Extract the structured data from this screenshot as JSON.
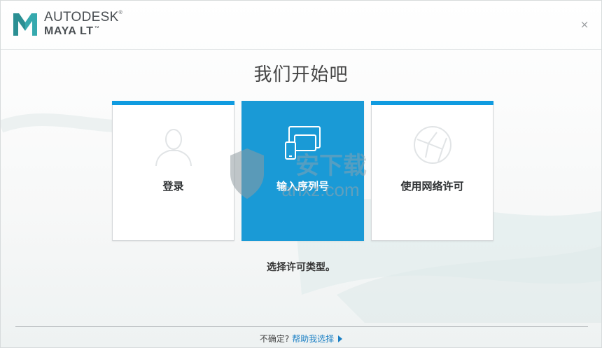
{
  "header": {
    "brand_top": "AUTODESK",
    "brand_top_mark": "®",
    "brand_bottom": "MAYA LT",
    "brand_bottom_mark": "™",
    "logo_icon": "maya-m-logo",
    "close_icon": "close-icon",
    "close_symbol": "×"
  },
  "main": {
    "title": "我们开始吧",
    "options": [
      {
        "label": "登录",
        "icon": "user-silhouette-icon",
        "selected": false
      },
      {
        "label": "输入序列号",
        "icon": "devices-icon",
        "selected": true
      },
      {
        "label": "使用网络许可",
        "icon": "network-globe-icon",
        "selected": false
      }
    ],
    "subtitle": "选择许可类型。"
  },
  "footer": {
    "question": "不确定?",
    "help_link": "帮助我选择",
    "arrow_icon": "triangle-right-icon"
  },
  "watermark": {
    "text": "安下载",
    "domain": "anxz.com"
  },
  "colors": {
    "accent": "#109be0",
    "selected_card": "#1a9ad6",
    "link": "#1a7fc4",
    "logo_teal": "#36a9ae"
  }
}
